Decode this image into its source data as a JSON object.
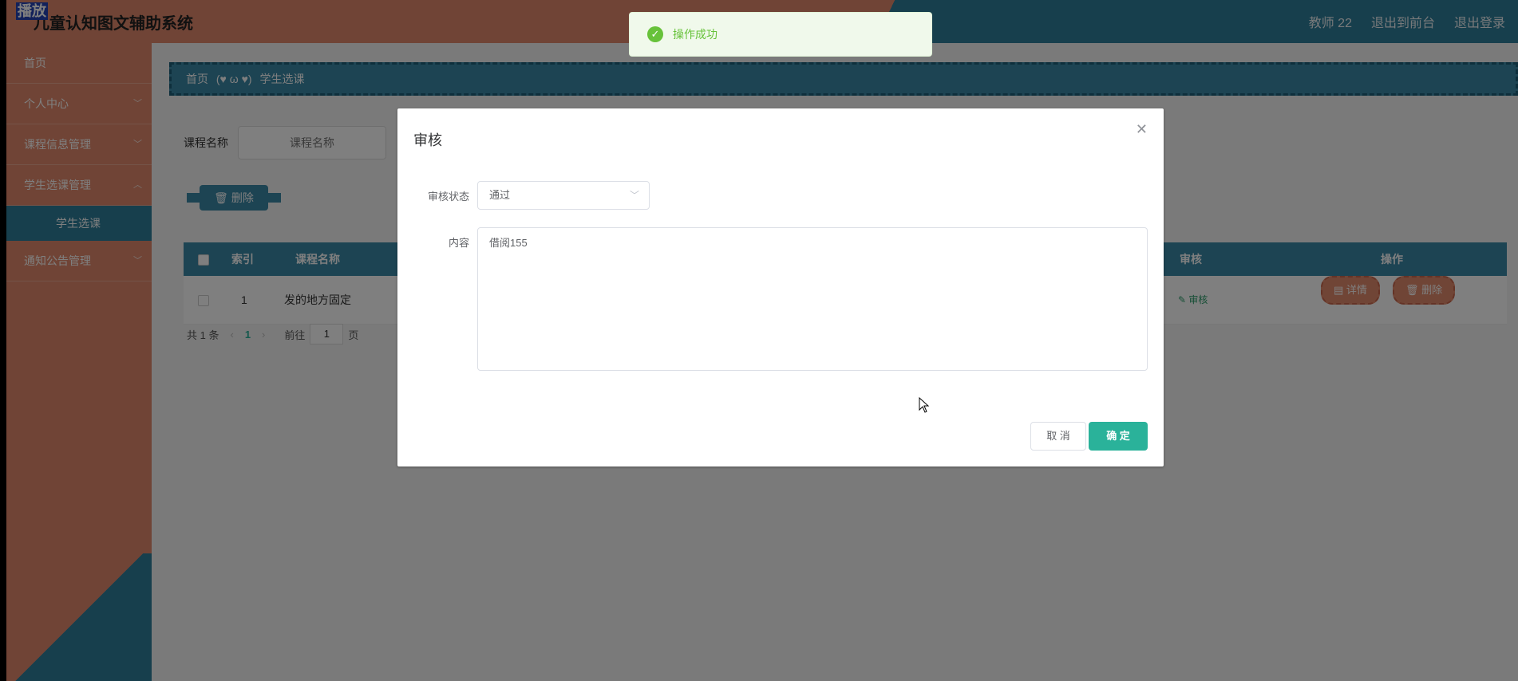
{
  "header": {
    "play_label": "播放",
    "title": "儿童认知图文辅助系统",
    "user": "教师 22",
    "to_front": "退出到前台",
    "logout": "退出登录"
  },
  "sidebar": {
    "items": [
      {
        "label": "首页"
      },
      {
        "label": "个人中心"
      },
      {
        "label": "课程信息管理"
      },
      {
        "label": "学生选课管理"
      },
      {
        "label": "学生选课"
      },
      {
        "label": "通知公告管理"
      }
    ]
  },
  "breadcrumb": {
    "home": "首页",
    "sep": "(♥ ω ♥)",
    "current": "学生选课"
  },
  "search": {
    "label": "课程名称",
    "placeholder": "课程名称"
  },
  "toolbar": {
    "delete_label": "删除"
  },
  "table": {
    "headers": {
      "index": "索引",
      "course": "课程名称",
      "audit": "审核",
      "ops": "操作"
    },
    "rows": [
      {
        "index": "1",
        "course": "发的地方固定",
        "audit": "审核",
        "detail": "详情",
        "delete": "删除"
      }
    ]
  },
  "pager": {
    "total": "共 1 条",
    "current": "1",
    "goto": "前往",
    "page_input": "1",
    "page_unit": "页"
  },
  "toast": {
    "message": "操作成功"
  },
  "dialog": {
    "title": "审核",
    "status_label": "审核状态",
    "status_value": "通过",
    "content_label": "内容",
    "content_value": "借阅155",
    "cancel": "取 消",
    "confirm": "确 定"
  },
  "colors": {
    "accent": "#3a88a6",
    "orange": "#e0896c",
    "teal": "#2ab29a",
    "success": "#67c23a"
  }
}
